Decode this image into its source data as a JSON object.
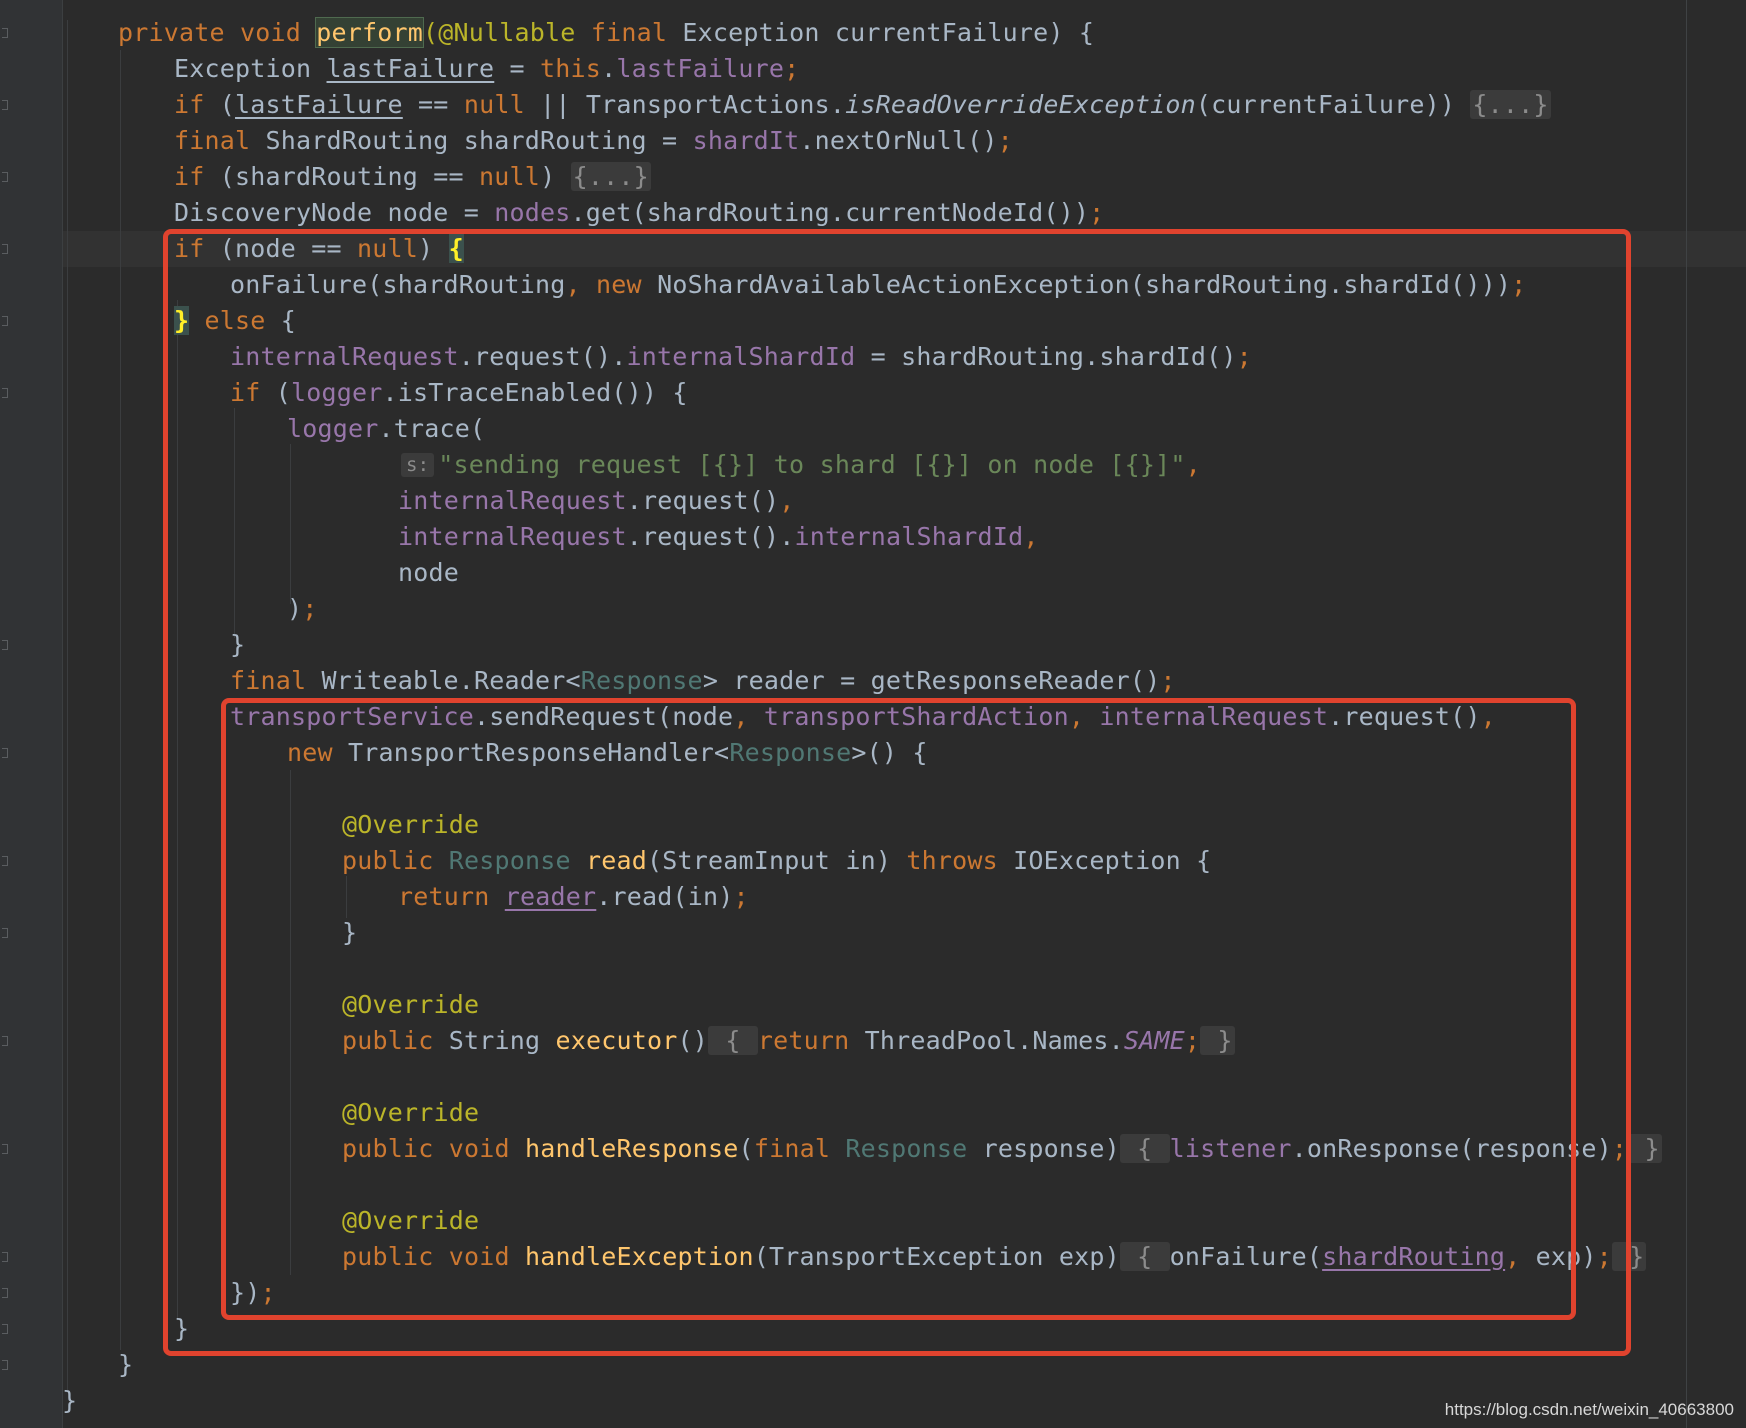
{
  "colors": {
    "background": "#2b2b2b",
    "keyword": "#cc7832",
    "field": "#9876aa",
    "string": "#6a8759",
    "annotation": "#bbb529",
    "method_decl": "#ffc66d",
    "generic_type": "#507874",
    "default_text": "#a9b7c6",
    "highlight_box": "#e0432e"
  },
  "code": {
    "l1_kw1": "private void ",
    "l1_fn": "perform",
    "l1_ann": "(@Nullable ",
    "l1_kw2": "final ",
    "l1_rest": "Exception currentFailure) {",
    "l2_a": "Exception ",
    "l2_var": "lastFailure",
    "l2_b": " = ",
    "l2_this": "this",
    "l2_c": ".",
    "l2_fld": "lastFailure",
    "l2_semi": ";",
    "l3_kw": "if ",
    "l3_a": "(",
    "l3_var": "lastFailure",
    "l3_b": " == ",
    "l3_null": "null",
    "l3_c": " || TransportActions.",
    "l3_ital": "isReadOverrideException",
    "l3_d": "(currentFailure)) ",
    "l3_fold": "{...}",
    "l4_kw": "final ",
    "l4_a": "ShardRouting shardRouting = ",
    "l4_fld": "shardIt",
    "l4_b": ".nextOrNull()",
    "l4_semi": ";",
    "l5_kw": "if ",
    "l5_a": "(shardRouting == ",
    "l5_null": "null",
    "l5_b": ") ",
    "l5_fold": "{...}",
    "l6_a": "DiscoveryNode node = ",
    "l6_fld": "nodes",
    "l6_b": ".get(shardRouting.currentNodeId())",
    "l6_semi": ";",
    "l7_kw": "if ",
    "l7_a": "(node == ",
    "l7_null": "null",
    "l7_b": ") ",
    "l7_brace": "{",
    "l8_a": "onFailure(shardRouting",
    "l8_comma": ", ",
    "l8_kw": "new ",
    "l8_b": "NoShardAvailableActionException(shardRouting.shardId()))",
    "l8_semi": ";",
    "l9_brace": "}",
    "l9_kw": " else ",
    "l9_a": "{",
    "l10_fld1": "internalRequest",
    "l10_a": ".request().",
    "l10_fld2": "internalShardId",
    "l10_b": " = shardRouting.shardId()",
    "l10_semi": ";",
    "l11_kw": "if ",
    "l11_a": "(",
    "l11_fld": "logger",
    "l11_b": ".isTraceEnabled()) {",
    "l12_fld": "logger",
    "l12_a": ".trace(",
    "l13_hint": "s:",
    "l13_str": "\"sending request [{}] to shard [{}] on node [{}]\"",
    "l13_comma": ",",
    "l14_fld": "internalRequest",
    "l14_a": ".request()",
    "l14_comma": ",",
    "l15_fld1": "internalRequest",
    "l15_a": ".request().",
    "l15_fld2": "internalShardId",
    "l15_comma": ",",
    "l16_a": "node",
    "l17_a": ")",
    "l17_semi": ";",
    "l18_a": "}",
    "l19_kw": "final ",
    "l19_a": "Writeable.Reader<",
    "l19_gen": "Response",
    "l19_b": "> reader = getResponseReader()",
    "l19_semi": ";",
    "l20_fld1": "transportService",
    "l20_a": ".sendRequest(node",
    "l20_c1": ", ",
    "l20_fld2": "transportShardAction",
    "l20_c2": ", ",
    "l20_fld3": "internalRequest",
    "l20_b": ".request()",
    "l20_c3": ",",
    "l21_kw": "new ",
    "l21_a": "TransportResponseHandler<",
    "l21_gen": "Response",
    "l21_b": ">() {",
    "l23_ann": "@Override",
    "l24_kw": "public ",
    "l24_gen": "Response ",
    "l24_fn": "read",
    "l24_a": "(StreamInput in) ",
    "l24_kw2": "throws ",
    "l24_b": "IOException {",
    "l25_kw": "return ",
    "l25_var": "reader",
    "l25_a": ".read(in)",
    "l25_semi": ";",
    "l26_a": "}",
    "l28_ann": "@Override",
    "l29_kw": "public ",
    "l29_a": "String ",
    "l29_fn": "executor",
    "l29_b": "()",
    "l29_fold1": " { ",
    "l29_kw2": "return ",
    "l29_c": "ThreadPool.Names.",
    "l29_ital": "SAME",
    "l29_semi": ";",
    "l29_fold2": " }",
    "l31_ann": "@Override",
    "l32_kw": "public void ",
    "l32_fn": "handleResponse",
    "l32_a": "(",
    "l32_kw2": "final ",
    "l32_gen": "Response ",
    "l32_b": "response)",
    "l32_fold1": " { ",
    "l32_fld": "listener",
    "l32_c": ".onResponse(response)",
    "l32_semi": ";",
    "l32_fold2": " }",
    "l34_ann": "@Override",
    "l35_kw": "public void ",
    "l35_fn": "handleException",
    "l35_a": "(TransportException exp)",
    "l35_fold1": " { ",
    "l35_b": "onFailure(",
    "l35_var": "shardRouting",
    "l35_comma": ", ",
    "l35_c": "exp)",
    "l35_semi": ";",
    "l35_fold2": " }",
    "l36_a": "})",
    "l36_semi": ";",
    "l37_a": "}",
    "l38_a": "}",
    "l39_a": "}"
  },
  "watermark": "https://blog.csdn.net/weixin_40663800"
}
